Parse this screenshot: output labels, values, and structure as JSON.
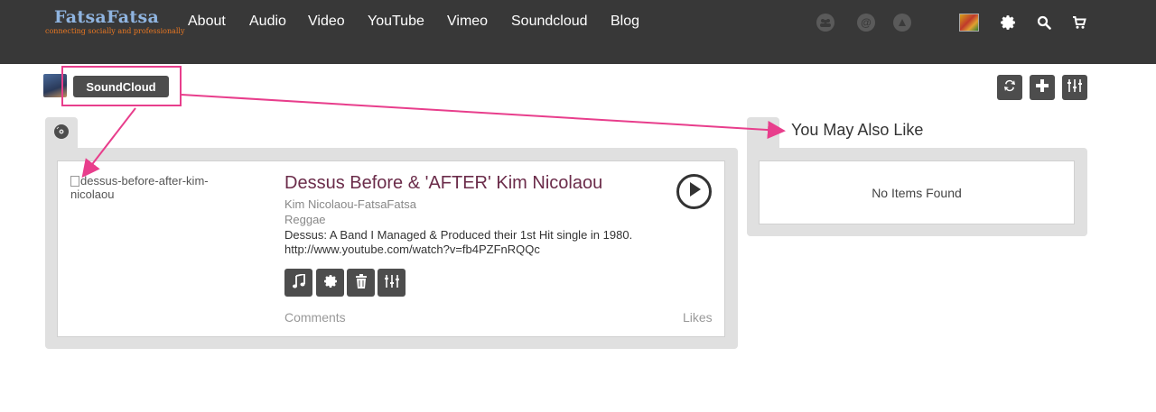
{
  "header": {
    "logo_title": "FatsaFatsa",
    "logo_tagline": "connecting socially and professionally",
    "nav_links": [
      "About",
      "Audio",
      "Video",
      "YouTube",
      "Vimeo",
      "Soundcloud",
      "Blog"
    ],
    "right_icons": [
      "groups-icon",
      "at-icon",
      "notification-icon",
      "flag-avatar-icon",
      "gear-icon",
      "search-icon",
      "cart-icon"
    ]
  },
  "profile": {
    "button_label": "SoundCloud"
  },
  "toolbar": {
    "icons": [
      "refresh-icon",
      "plus-icon",
      "sliders-icon"
    ]
  },
  "track": {
    "image_alt": "dessus-before-after-kim-nicolaou",
    "title": "Dessus Before & 'AFTER' Kim Nicolaou",
    "artist": "Kim Nicolaou-FatsaFatsa",
    "genre": "Reggae",
    "description": "Dessus: A Band I Managed & Produced their 1st Hit single in 1980. http://www.youtube.com/watch?v=fb4PZFnRQQc",
    "actions": [
      "music-icon",
      "gear-icon",
      "trash-icon",
      "sliders-icon"
    ],
    "comments_label": "Comments",
    "likes_label": "Likes"
  },
  "sidebar": {
    "heading": "You May Also Like",
    "empty_text": "No Items Found"
  },
  "colors": {
    "topbar": "#383838",
    "button": "#4d4d4d",
    "panel": "#e0e0e0",
    "title": "#6b2c4a",
    "annotation": "#e83e8c"
  }
}
